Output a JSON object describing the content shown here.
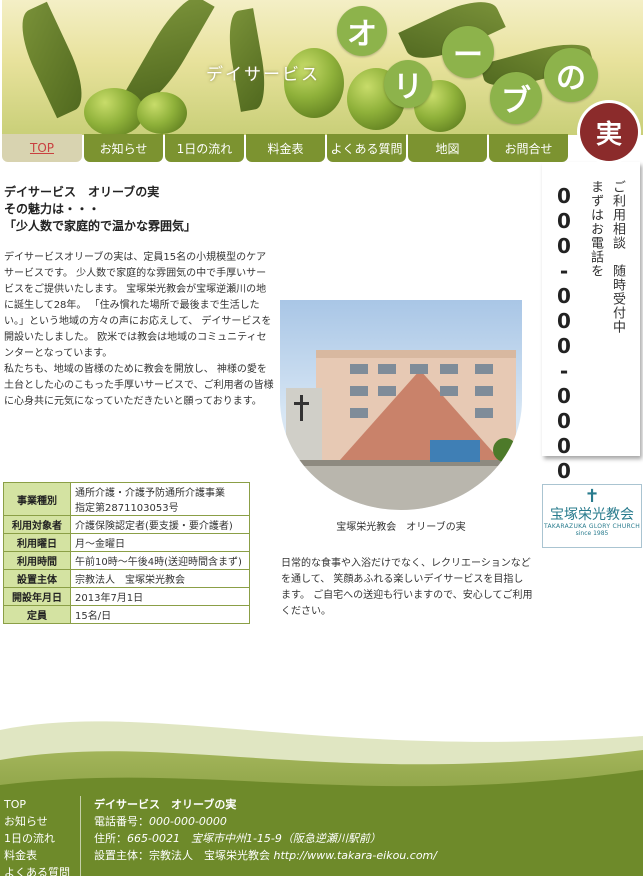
{
  "header": {
    "brand_small": "デイサービス",
    "brand_chars": [
      "オ",
      "リ",
      "ー",
      "ブ",
      "の"
    ],
    "brand_red": "実"
  },
  "nav": [
    {
      "label": "TOP",
      "active": true
    },
    {
      "label": "お知らせ"
    },
    {
      "label": "1日の流れ"
    },
    {
      "label": "料金表"
    },
    {
      "label": "よくある質問"
    },
    {
      "label": "地図"
    },
    {
      "label": "お問合せ"
    }
  ],
  "intro": {
    "title1": "デイサービス　オリーブの実",
    "title2": "その魅力は・・・",
    "title3": "「少人数で家庭的で温かな雰囲気」",
    "body": [
      "デイサービスオリーブの実は、定員15名の小規模型のケアサービスです。 少人数で家庭的な雰囲気の中で手厚いサービスをご提供いたします。 宝塚栄光教会が宝塚逆瀬川の地に誕生して28年。 「住み慣れた場所で最後まで生活したい。」という地域の方々の声にお応えして、 デイサービスを開設いたしました。 欧米では教会は地域のコミュニティセンターとなっています。",
      "私たちも、地域の皆様のために教会を開放し、 神様の愛を土台とした心のこもった手厚いサービスで、ご利用者の皆様に心身共に元気になっていただきたいと願っております。"
    ]
  },
  "info_table": [
    {
      "label": "事業種別",
      "value": "通所介護・介護予防通所介護事業\n指定第2871103053号"
    },
    {
      "label": "利用対象者",
      "value": "介護保険認定者(要支援・要介護者)"
    },
    {
      "label": "利用曜日",
      "value": "月～金曜日"
    },
    {
      "label": "利用時間",
      "value": "午前10時～午後4時(送迎時間含まず)"
    },
    {
      "label": "設置主体",
      "value": "宗教法人　宝塚栄光教会"
    },
    {
      "label": "開設年月日",
      "value": "2013年7月1日"
    },
    {
      "label": "定員",
      "value": "15名/日"
    }
  ],
  "photo": {
    "caption": "宝塚栄光教会　オリーブの実"
  },
  "description": "日常的な食事や入浴だけでなく、レクリエーションなどを通して、 笑顔あふれる楽しいデイサービスを目指します。 ご自宅への送迎も行いますので、安心してご利用ください。",
  "contact": {
    "line1": "ご利用相談　随時受付中",
    "line2": "まずはお電話を",
    "phone": "000-000-0000"
  },
  "logo": {
    "name": "宝塚栄光教会",
    "en": "TAKARAZUKA GLORY CHURCH",
    "since": "since 1985"
  },
  "footer": {
    "links": [
      "TOP",
      "お知らせ",
      "1日の流れ",
      "料金表",
      "よくある質問"
    ],
    "name": "デイサービス　オリーブの実",
    "tel_label": "電話番号：",
    "tel": "000-000-0000",
    "addr_label": "住所：",
    "addr": "665-0021　宝塚市中州1-15-9（阪急逆瀬川駅前）",
    "org_label": "設置主体：宗教法人　宝塚栄光教会 ",
    "url": "http://www.takara-eikou.com/"
  },
  "colors": {
    "nav_green": "#7c9330",
    "bubble_green": "#8db34b",
    "red_accent": "#8b2b2b",
    "table_header": "#d4e3a2",
    "footer_green": "#6e8a2a"
  }
}
